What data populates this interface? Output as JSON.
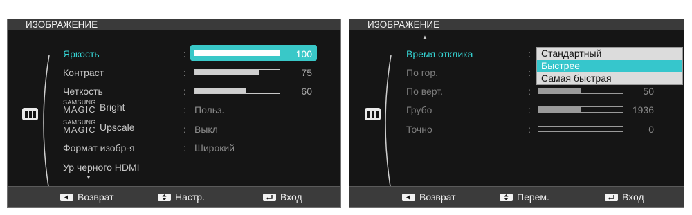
{
  "left_panel": {
    "title": "ИЗОБРАЖЕНИЕ",
    "items": [
      {
        "label": "Яркость",
        "state": "active",
        "value_type": "slider",
        "value": 100,
        "level": 1.0
      },
      {
        "label": "Контраст",
        "value_type": "slider",
        "value": 75,
        "level": 0.75
      },
      {
        "label": "Четкость",
        "value_type": "slider",
        "value": 60,
        "level": 0.6
      },
      {
        "brand_top": "SAMSUNG",
        "brand_mid": "MAGIC",
        "label": "Bright",
        "value_type": "text",
        "value": "Польз."
      },
      {
        "brand_top": "SAMSUNG",
        "brand_mid": "MAGIC",
        "label": "Upscale",
        "value_type": "text",
        "value": "Выкл"
      },
      {
        "label": "Формат изобр-я",
        "value_type": "text",
        "value": "Широкий"
      },
      {
        "label": "Ур черного HDMI"
      }
    ],
    "colon": ":",
    "scroll_down": "▼",
    "footer": {
      "back": "Возврат",
      "adjust": "Настр.",
      "enter": "Вход"
    }
  },
  "right_panel": {
    "title": "ИЗОБРАЖЕНИЕ",
    "scroll_up": "▲",
    "items": [
      {
        "label": "Время отклика",
        "state": "active",
        "value_type": "dropdown"
      },
      {
        "label": "По гор.",
        "state": "disabled"
      },
      {
        "label": "По верт.",
        "state": "disabled",
        "value_type": "slider",
        "value": 50,
        "level": 0.5
      },
      {
        "label": "Грубо",
        "state": "disabled",
        "value_type": "slider",
        "value": 1936,
        "level": 0.5
      },
      {
        "label": "Точно",
        "state": "disabled",
        "value_type": "slider",
        "value": 0,
        "level": 0.0
      }
    ],
    "colon": ":",
    "dropdown": {
      "options": [
        "Стандартный",
        "Быстрее",
        "Самая быстрая"
      ],
      "selected_index": 1
    },
    "footer": {
      "back": "Возврат",
      "move": "Перем.",
      "enter": "Вход"
    }
  },
  "colors": {
    "panel_bg": "#151515",
    "title_bg": "#3a3a3a",
    "accent": "#35d2d2",
    "highlight": "#39c8c8"
  },
  "icons": {
    "side": "picture-menu-icon",
    "back": "left-arrow-key-icon",
    "adjust": "up-down-key-icon",
    "move": "up-down-key-icon",
    "enter": "enter-key-icon"
  }
}
